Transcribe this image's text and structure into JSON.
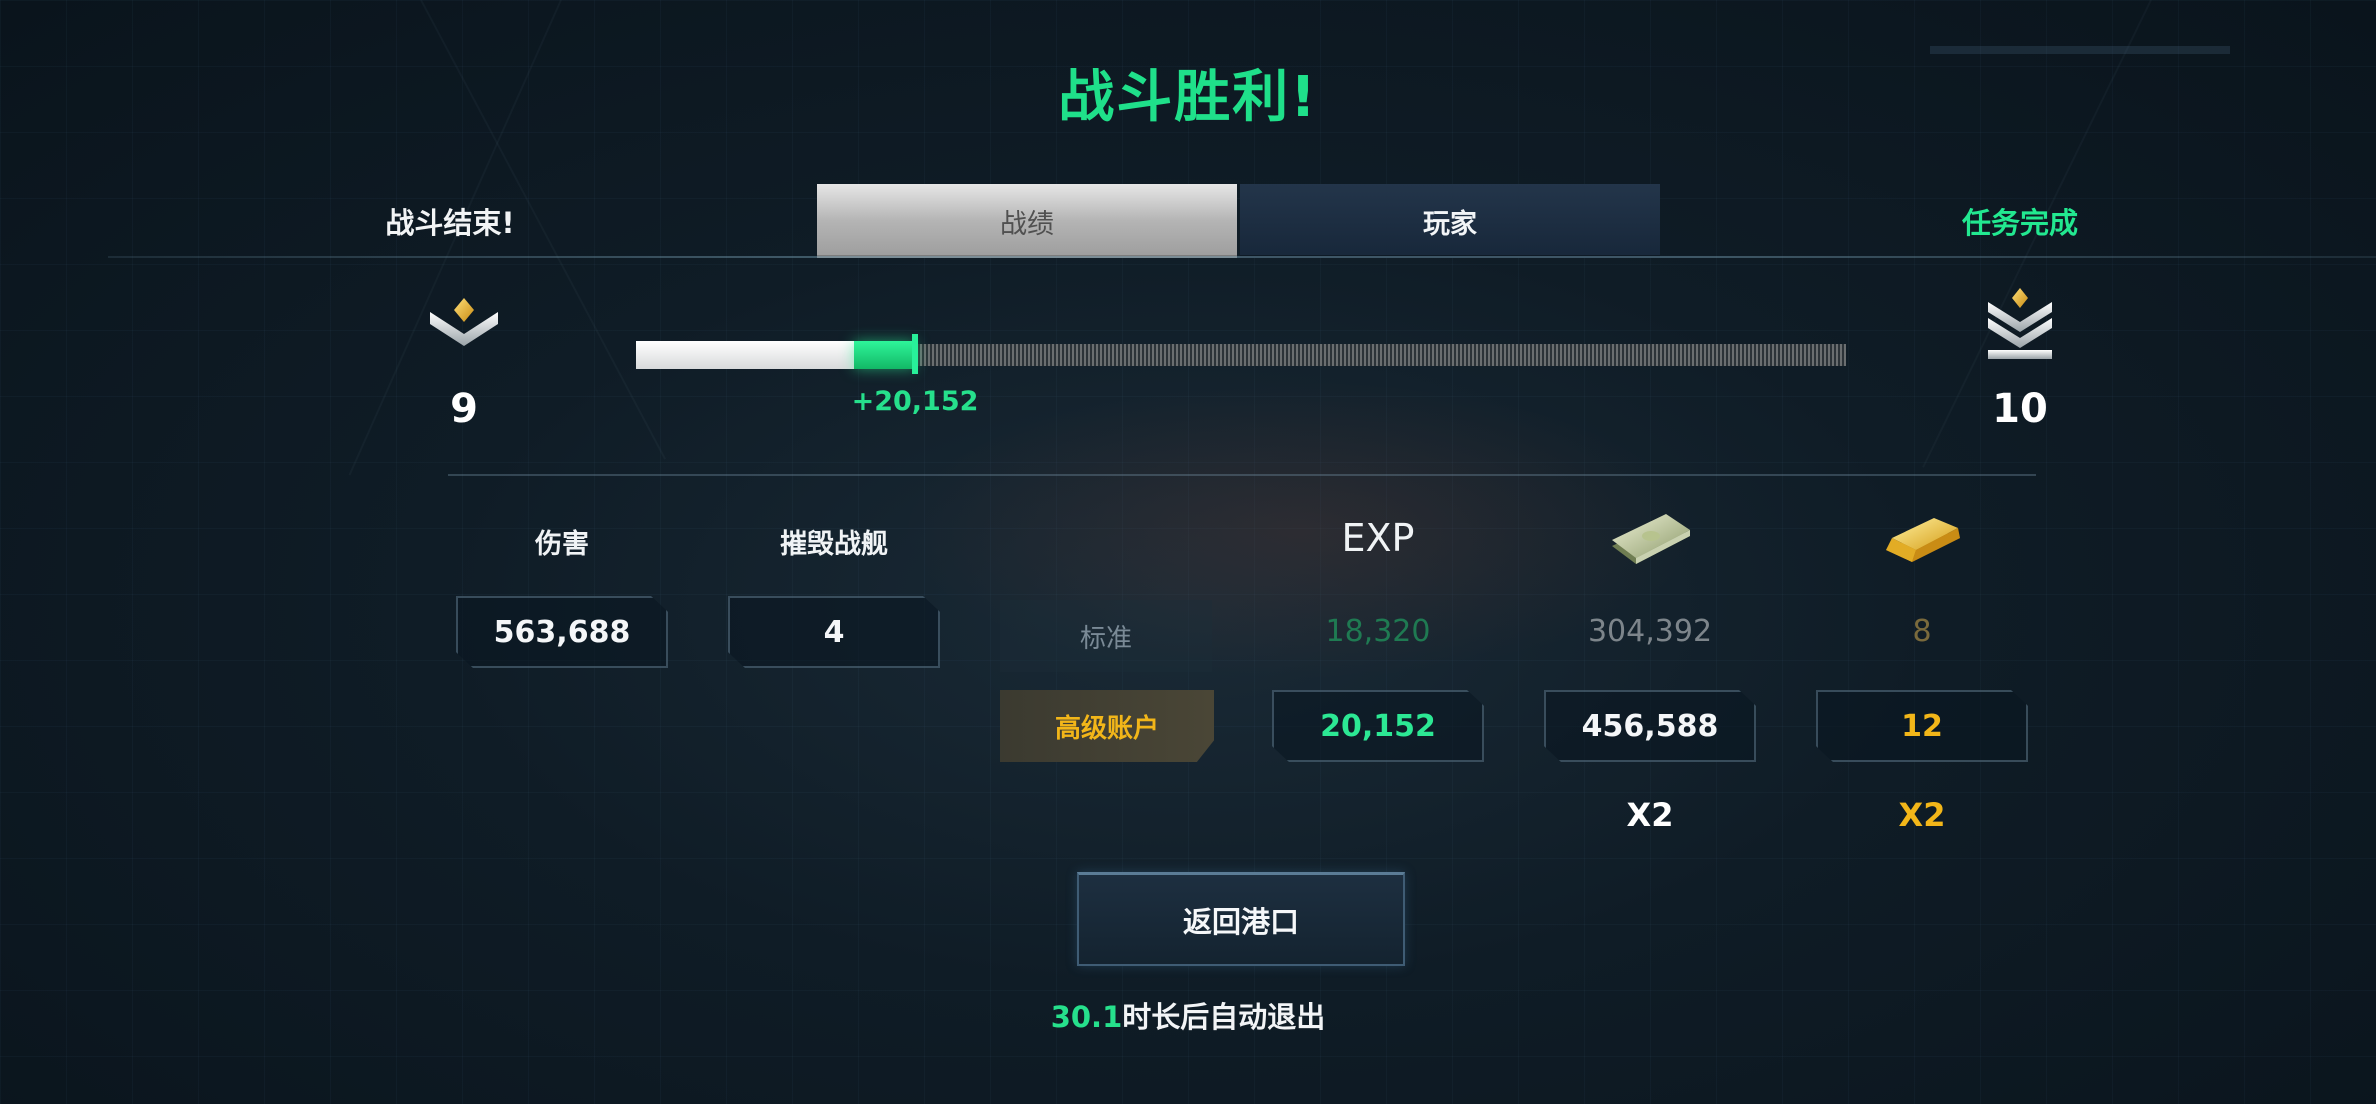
{
  "header": {
    "title": "战斗胜利!",
    "left_status": "战斗结束!",
    "right_status": "任务完成",
    "tabs": [
      {
        "label": "战绩",
        "active": true
      },
      {
        "label": "玩家",
        "active": false
      }
    ]
  },
  "progress": {
    "current_rank": "9",
    "next_rank": "10",
    "exp_gain": "+20,152",
    "base_fill_fraction": 0.18,
    "gain_fill_fraction": 0.05
  },
  "stats": {
    "damage_label": "伤害",
    "damage_value": "563,688",
    "kills_label": "摧毁战舰",
    "kills_value": "4"
  },
  "rewards": {
    "exp_label": "EXP",
    "cash_icon": "cash-icon",
    "gold_icon": "gold-bar-icon",
    "standard_label": "标准",
    "standard": {
      "exp": "18,320",
      "cash": "304,392",
      "gold": "8"
    },
    "premium_label": "高级账户",
    "premium": {
      "exp": "20,152",
      "cash": "456,588",
      "gold": "12"
    },
    "cash_multiplier": "X2",
    "gold_multiplier": "X2"
  },
  "footer": {
    "return_button": "返回港口",
    "countdown_value": "30.1",
    "countdown_text": "时长后自动退出"
  },
  "colors": {
    "accent_green": "#1fe08a",
    "gold": "#f2b619",
    "background": "#0f1c26"
  }
}
